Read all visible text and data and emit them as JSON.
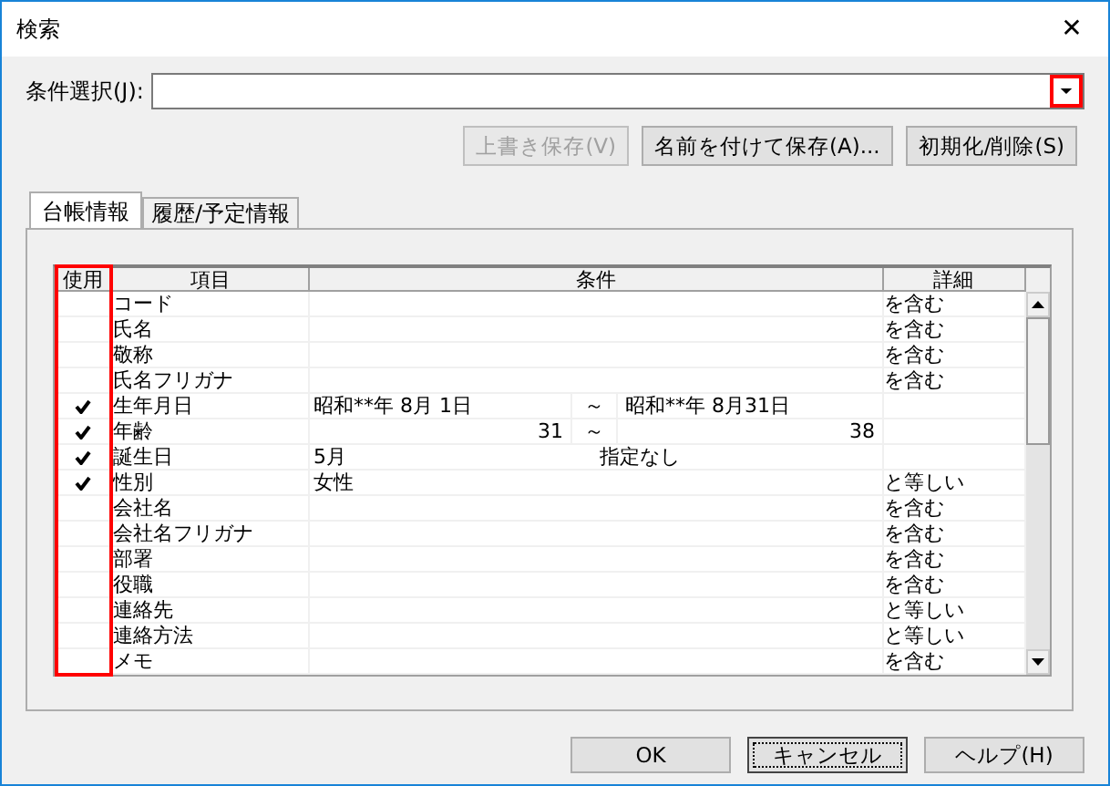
{
  "window": {
    "title": "検索",
    "close": "✕"
  },
  "condition_select": {
    "label": "条件選択(J):",
    "value_highlighted": true
  },
  "actions": [
    {
      "label": "上書き保存(V)",
      "disabled": true
    },
    {
      "label": "名前を付けて保存(A)...",
      "disabled": false
    },
    {
      "label": "初期化/削除(S)",
      "disabled": false
    }
  ],
  "tabs": [
    {
      "label": "台帳情報",
      "selected": true
    },
    {
      "label": "履歴/予定情報",
      "selected": false
    }
  ],
  "table": {
    "columns": [
      {
        "label": "使用",
        "highlighted": true
      },
      {
        "label": "項目",
        "highlighted": false
      },
      {
        "label": "条件",
        "highlighted": false
      },
      {
        "label": "詳細",
        "highlighted": false
      }
    ],
    "rows": [
      {
        "item": "コード",
        "checked": false,
        "detail": "を含む"
      },
      {
        "item": "氏名",
        "checked": false,
        "detail": "を含む"
      },
      {
        "item": "敬称",
        "checked": false,
        "detail": "を含む"
      },
      {
        "item": "氏名フリガナ",
        "checked": false,
        "detail": "を含む"
      },
      {
        "item": "生年月日",
        "checked": true,
        "condition": {
          "kind": "range",
          "from": "昭和**年 8月 1日",
          "sep": "～",
          "to": "昭和**年 8月31日"
        }
      },
      {
        "item": "年齢",
        "checked": true,
        "condition": {
          "kind": "number_range",
          "from": "31",
          "sep": "～",
          "to": "38"
        }
      },
      {
        "item": "誕生日",
        "checked": true,
        "condition": {
          "kind": "month",
          "from": " 5月",
          "to": "指定なし"
        }
      },
      {
        "item": "性別",
        "checked": true,
        "condition": {
          "kind": "text",
          "from": "女性"
        },
        "detail": "と等しい"
      },
      {
        "item": "会社名",
        "checked": false,
        "detail": "を含む"
      },
      {
        "item": "会社名フリガナ",
        "checked": false,
        "detail": "を含む"
      },
      {
        "item": "部署",
        "checked": false,
        "detail": "を含む"
      },
      {
        "item": "役職",
        "checked": false,
        "detail": "を含む"
      },
      {
        "item": "連絡先",
        "checked": false,
        "detail": "と等しい"
      },
      {
        "item": "連絡方法",
        "checked": false,
        "detail": "と等しい"
      },
      {
        "item": "メモ",
        "checked": false,
        "detail": "を含む"
      }
    ]
  },
  "buttons": [
    {
      "label": "OK",
      "focused": false
    },
    {
      "label": "キャンセル",
      "focused": true
    },
    {
      "label": "ヘルプ(H)",
      "focused": false
    }
  ]
}
